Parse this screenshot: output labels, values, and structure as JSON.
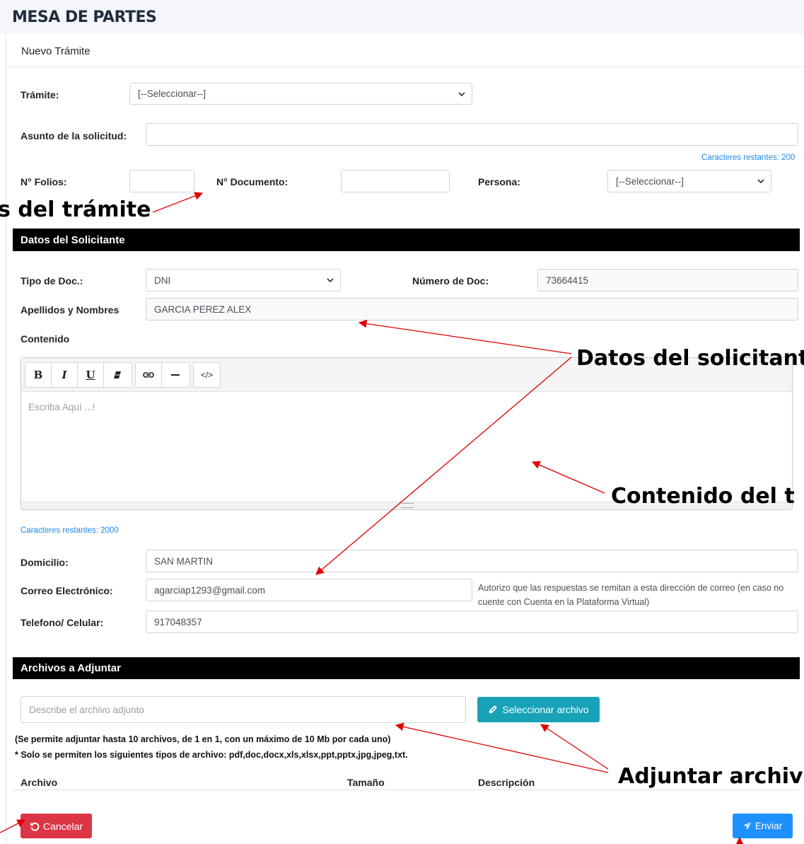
{
  "app": {
    "title": "MESA DE PARTES"
  },
  "page": {
    "subtitle": "Nuevo Trámite"
  },
  "tramite": {
    "tramite_label": "Trámite:",
    "tramite_value": "[--Seleccionar--]",
    "asunto_label": "Asunto de la solicitud:",
    "asunto_value": "",
    "caracteres_restantes": "Caracteres restantes: 200",
    "folios_label": "N° Folios:",
    "folios_value": "",
    "documento_label": "N° Documento:",
    "documento_value": "",
    "persona_label": "Persona:",
    "persona_value": "[--Seleccionar--]"
  },
  "solicitante": {
    "section_title": "Datos del Solicitante",
    "tipo_doc_label": "Tipo de Doc.:",
    "tipo_doc_value": "DNI",
    "numero_doc_label": "Número de Doc:",
    "numero_doc_value": "73664415",
    "nombres_label": "Apellidos y Nombres",
    "nombres_value": "GARCIA PEREZ ALEX",
    "contenido_label": "Contenido",
    "editor_placeholder": "Escriba Aquí ...!",
    "caracteres_restantes": "Caracteres restantes: 2000",
    "domicilio_label": "Domicilio:",
    "domicilio_value": "SAN MARTIN",
    "correo_label": "Correo Electrónico:",
    "correo_value": "agarciap1293@gmail.com",
    "autorizo_text": "Autorizo que las respuestas se remitan a esta dirección de correo (en caso no cuente con Cuenta en la Plataforma Virtual)",
    "telefono_label": "Telefono/ Celular:",
    "telefono_value": "917048357"
  },
  "editor_toolbar": {
    "bold": "B",
    "italic": "I",
    "underline": "U",
    "code": "</>"
  },
  "adjuntos": {
    "section_title": "Archivos a Adjuntar",
    "describe_placeholder": "Describe el archivo adjunto",
    "select_button": "Seleccionar archivo",
    "note1": "(Se permite adjuntar hasta 10 archivos, de 1 en 1, con un máximo de 10 Mb por cada uno)",
    "note2": "* Solo se permiten los siguientes tipos de archivo: pdf,doc,docx,xls,xlsx,ppt,pptx,jpg,jpeg,txt.",
    "table_headers": [
      "Archivo",
      "Tamaño",
      "Descripción"
    ]
  },
  "actions": {
    "cancel": "Cancelar",
    "submit": "Enviar"
  },
  "annotations": {
    "datos_tramite": "s del trámite",
    "datos_solicitante": "Datos del solicitant",
    "contenido": "Contenido del t",
    "adjuntar": "Adjuntar archiv"
  },
  "colors": {
    "cancel": "#dc3545",
    "submit": "#1e90ff",
    "select_file": "#17a2b8",
    "section_bar": "#000000",
    "arrow": "#e00000",
    "link_blue": "#1e88e5"
  },
  "icons": {
    "chevron": "chevron-down-icon",
    "link": "link-icon",
    "clear_format": "eraser-icon",
    "horizontal_rule": "horizontal-rule-icon",
    "paperclip": "paperclip-icon",
    "undo": "undo-icon",
    "send": "paper-plane-icon"
  }
}
